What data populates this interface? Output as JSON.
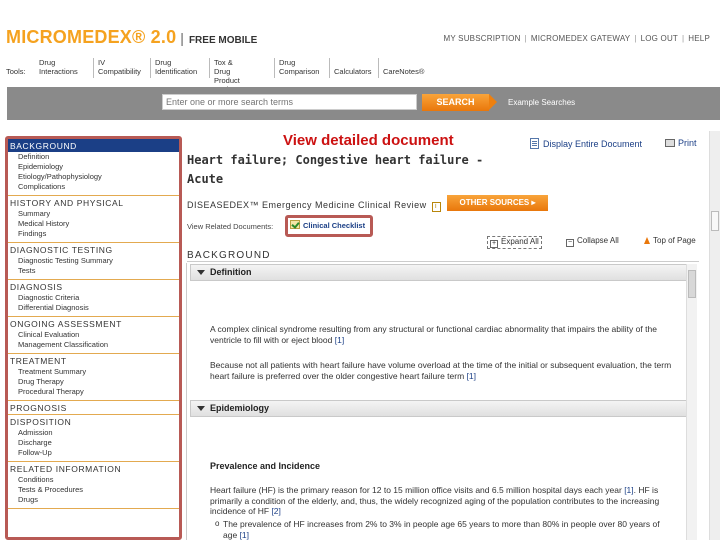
{
  "header": {
    "logo_text": "MICROMEDEX® 2.0",
    "logo_separator": "|",
    "logo_sub": "FREE MOBILE",
    "top_links": [
      "MY SUBSCRIPTION",
      "MICROMEDEX GATEWAY",
      "LOG OUT",
      "HELP"
    ],
    "tools_label": "Tools:",
    "tools": [
      {
        "line1": "Drug",
        "line2": "Interactions"
      },
      {
        "line1": "IV Compatibility",
        "line2": ""
      },
      {
        "line1": "Drug",
        "line2": "Identification"
      },
      {
        "line1": "Tox & Drug",
        "line2": "Product Lookup"
      },
      {
        "line1": "Drug",
        "line2": "Comparison"
      },
      {
        "line1": "Calculators",
        "line2": ""
      },
      {
        "line1": "CareNotes®",
        "line2": ""
      }
    ]
  },
  "search": {
    "placeholder": "Enter one or more search terms",
    "button_label": "SEARCH",
    "example_link": "Example Searches"
  },
  "callout": {
    "label": "View detailed document"
  },
  "sidebar": {
    "sections": [
      {
        "heading": "BACKGROUND",
        "active": true,
        "items": [
          "Definition",
          "Epidemiology",
          "Etiology/Pathophysiology",
          "Complications"
        ]
      },
      {
        "heading": "HISTORY AND PHYSICAL",
        "active": false,
        "items": [
          "Summary",
          "Medical History",
          "Findings"
        ]
      },
      {
        "heading": "DIAGNOSTIC TESTING",
        "active": false,
        "items": [
          "Diagnostic Testing Summary",
          "Tests"
        ]
      },
      {
        "heading": "DIAGNOSIS",
        "active": false,
        "items": [
          "Diagnostic Criteria",
          "Differential Diagnosis"
        ]
      },
      {
        "heading": "ONGOING ASSESSMENT",
        "active": false,
        "items": [
          "Clinical Evaluation",
          "Management Classification"
        ]
      },
      {
        "heading": "TREATMENT",
        "active": false,
        "items": [
          "Treatment Summary",
          "Drug Therapy",
          "Procedural Therapy"
        ]
      },
      {
        "heading": "PROGNOSIS",
        "active": false,
        "items": []
      },
      {
        "heading": "DISPOSITION",
        "active": false,
        "items": [
          "Admission",
          "Discharge",
          "Follow-Up"
        ]
      },
      {
        "heading": "RELATED INFORMATION",
        "active": false,
        "items": [
          "Conditions",
          "Tests & Procedures",
          "Drugs"
        ]
      }
    ]
  },
  "document": {
    "title": "Heart failure; Congestive heart failure - Acute",
    "display_entire": "Display Entire Document",
    "print": "Print",
    "source": "DISEASEDEX™ Emergency Medicine Clinical Review",
    "info_icon": "i",
    "other_sources": "OTHER SOURCES ▸",
    "related_label": "View Related Documents:",
    "clinical_checklist": "Clinical Checklist",
    "expand_all": "Expand All",
    "collapse_all": "Collapse All",
    "top_of_page": "Top of Page",
    "section_title": "BACKGROUND",
    "subsections": [
      {
        "title": "Definition"
      },
      {
        "title": "Epidemiology"
      }
    ],
    "definition_para1": "A complex clinical syndrome resulting from any structural or functional cardiac abnormality that impairs the ability of the ventricle to fill with or eject blood",
    "definition_ref1": "[1]",
    "definition_para2": "Because not all patients with heart failure have volume overload at the time of the initial or subsequent evaluation, the term heart failure is preferred over the older congestive heart failure term",
    "definition_ref2": "[1]",
    "epi_heading": "Prevalence and Incidence",
    "epi_para": "Heart failure (HF) is the primary reason for 12 to 15 million office visits and 6.5 million hospital days each year",
    "epi_ref1": "[1]",
    "epi_para_cont": ". HF is primarily a condition of the elderly, and, thus, the widely recognized aging of the population contributes to the increasing incidence of HF",
    "epi_ref2": "[2]",
    "bullet1": "The prevalence of HF increases from 2% to 3% in people age 65 years to more than 80% in people over 80 years of age",
    "bullet1_ref": "[1]"
  }
}
